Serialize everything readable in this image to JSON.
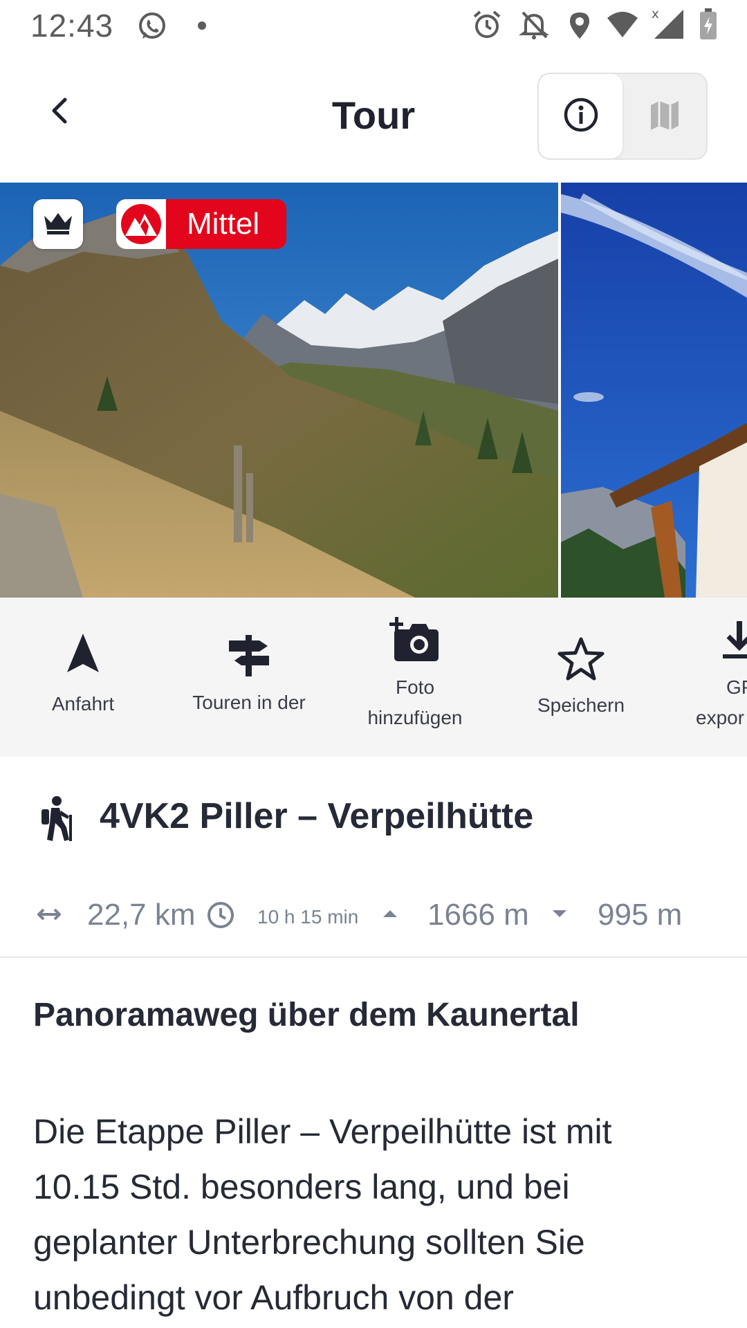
{
  "status_bar": {
    "time": "12:43",
    "icons": [
      "whatsapp-icon",
      "dot-icon",
      "alarm-icon",
      "notifications-off-icon",
      "location-icon",
      "wifi-icon",
      "signal-icon",
      "battery-charging-icon"
    ]
  },
  "app_bar": {
    "title": "Tour",
    "back_icon": "chevron-left-icon",
    "view_toggle": [
      {
        "icon": "info-icon",
        "active": true
      },
      {
        "icon": "map-icon",
        "active": false
      }
    ]
  },
  "gallery": {
    "premium_icon": "crown-icon",
    "difficulty_label": "Mittel",
    "difficulty_color": "#e3051b"
  },
  "actions": [
    {
      "icon": "navigation-arrow-icon",
      "label": "Anfahrt"
    },
    {
      "icon": "signpost-icon",
      "label": "Touren in der"
    },
    {
      "icon": "add-photo-icon",
      "label_line1": "Foto",
      "label_line2": "hinzufügen"
    },
    {
      "icon": "star-icon",
      "label": "Speichern"
    },
    {
      "icon": "download-icon",
      "label_line1": "GP",
      "label_line2": "expor"
    }
  ],
  "tour": {
    "icon": "hiker-icon",
    "title": "4VK2 Piller – Verpeilhütte",
    "distance": "22,7 km",
    "duration": "10 h 15 min",
    "ascent": "1666 m",
    "descent": "995 m",
    "subtitle": "Panoramaweg über dem Kaunertal",
    "description": "Die Etappe Piller – Verpeilhütte ist mit 10.15 Std. besonders lang, und bei geplanter Unterbrechung sollten Sie unbedingt vor Aufbruch von der"
  }
}
